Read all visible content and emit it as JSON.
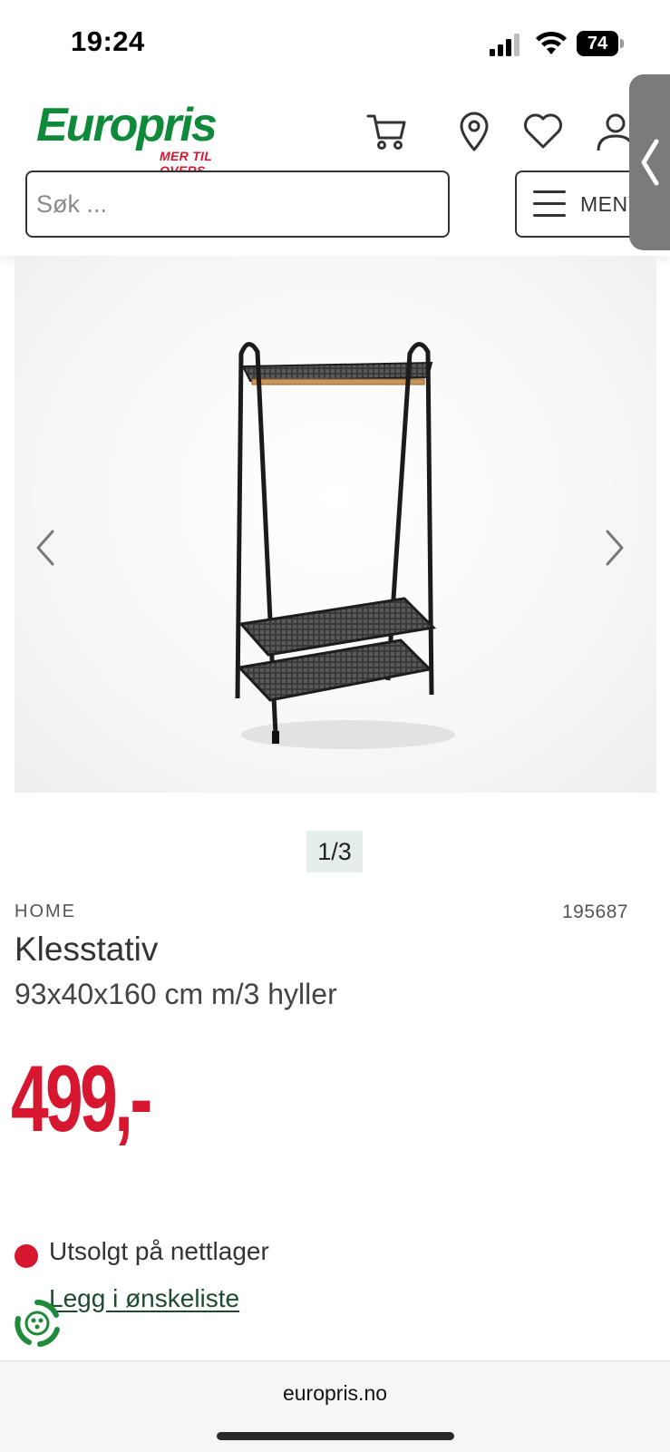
{
  "status_bar": {
    "time": "19:24",
    "battery": "74"
  },
  "header": {
    "logo_text": "Europris",
    "logo_tagline": "MER TIL OVERS",
    "search_placeholder": "Søk ...",
    "menu_label": "MENY",
    "icons": [
      "cart-icon",
      "location-pin-icon",
      "heart-icon",
      "user-icon",
      "chevron-left-icon"
    ]
  },
  "gallery": {
    "counter": "1/3",
    "icons": [
      "chevron-left-icon",
      "chevron-right-icon"
    ]
  },
  "product": {
    "brand": "HOME",
    "sku": "195687",
    "title": "Klesstativ",
    "subtitle": "93x40x160 cm m/3 hyller",
    "price": "499,-"
  },
  "availability": {
    "stock_status": "Utsolgt på nettlager",
    "wishlist_link": "Legg i ønskeliste"
  },
  "footer": {
    "url": "europris.no"
  },
  "colors": {
    "brand_green": "#0f8a3a",
    "price_red": "#d7172f",
    "counter_bg": "#e3efe8",
    "link_green": "#1f4a30"
  }
}
